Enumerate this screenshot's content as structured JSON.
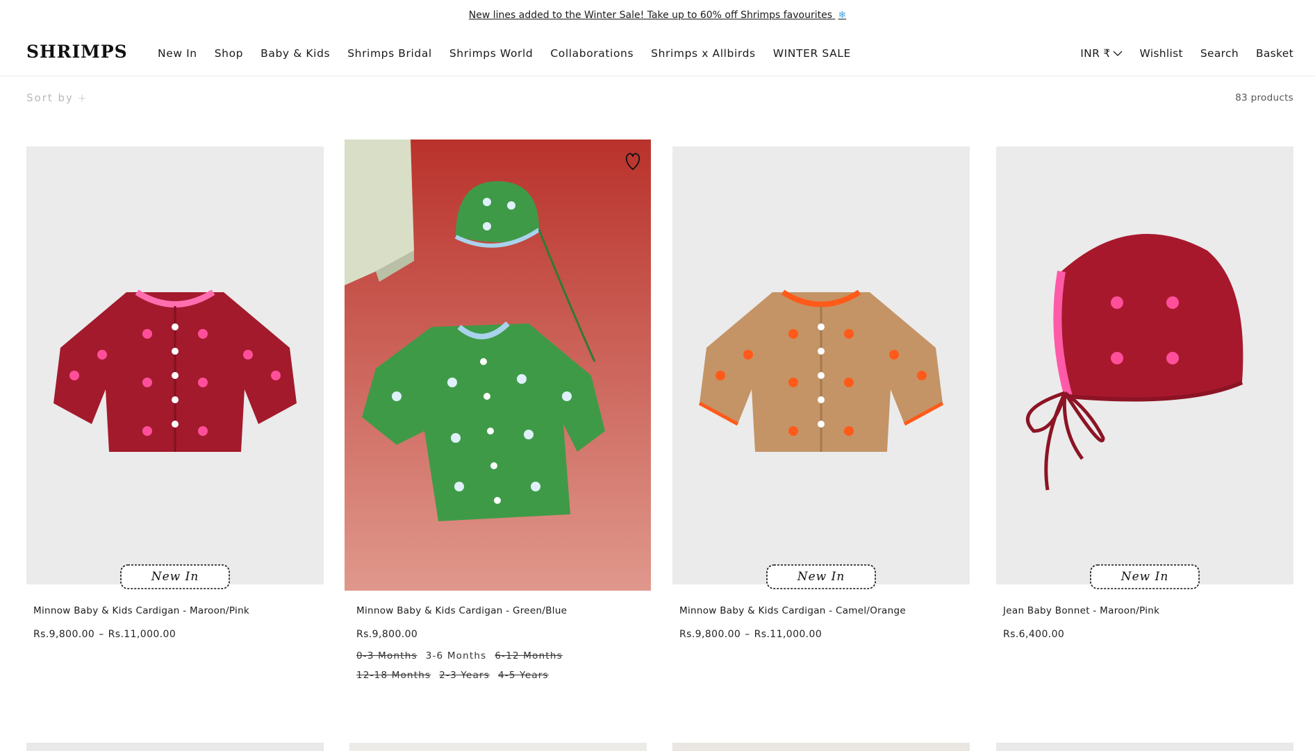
{
  "announcement": {
    "text": "New lines added to the Winter Sale! Take up to 60% off Shrimps favourites",
    "icon": "snowflake-icon",
    "icon_glyph": "❄"
  },
  "header": {
    "logo": "SHRIMPS",
    "nav": [
      "New In",
      "Shop",
      "Baby & Kids",
      "Shrimps Bridal",
      "Shrimps World",
      "Collaborations",
      "Shrimps x Allbirds",
      "WINTER SALE"
    ],
    "currency": "INR ₹",
    "wishlist": "Wishlist",
    "search": "Search",
    "basket": "Basket"
  },
  "toolbar": {
    "sort_label": "Sort by",
    "sort_icon": "+",
    "product_count": "83 products"
  },
  "products": [
    {
      "name": "Minnow Baby & Kids Cardigan - Maroon/Pink",
      "price_from": "Rs.9,800.00",
      "price_sep": "–",
      "price_to": "Rs.11,000.00",
      "badge": "New In",
      "colors": {
        "body": "#a31a2c",
        "trim": "#ff6fb0",
        "flower": "#ff4f9a"
      }
    },
    {
      "name": "Minnow Baby & Kids Cardigan - Green/Blue",
      "price": "Rs.9,800.00",
      "sizes": [
        {
          "label": "0-3 Months",
          "available": false
        },
        {
          "label": "3-6 Months",
          "available": true
        },
        {
          "label": "6-12 Months",
          "available": false
        },
        {
          "label": "12-18 Months",
          "available": false
        },
        {
          "label": "2-3 Years",
          "available": false
        },
        {
          "label": "4-5 Years",
          "available": false
        }
      ],
      "colors": {
        "body": "#3f9a47",
        "trim": "#a9d3ec",
        "flower": "#dff0fb",
        "background": "#c2392f"
      },
      "wishlist_icon": "heart-icon"
    },
    {
      "name": "Minnow Baby & Kids Cardigan - Camel/Orange",
      "price_from": "Rs.9,800.00",
      "price_sep": "–",
      "price_to": "Rs.11,000.00",
      "badge": "New In",
      "colors": {
        "body": "#c49466",
        "trim": "#ff5a1a",
        "flower": "#ff5a1a"
      }
    },
    {
      "name": "Jean Baby Bonnet - Maroon/Pink",
      "price": "Rs.6,400.00",
      "badge": "New In",
      "colors": {
        "body": "#a8182c",
        "trim": "#ff5aa8",
        "flower": "#ff4f9a"
      }
    }
  ]
}
